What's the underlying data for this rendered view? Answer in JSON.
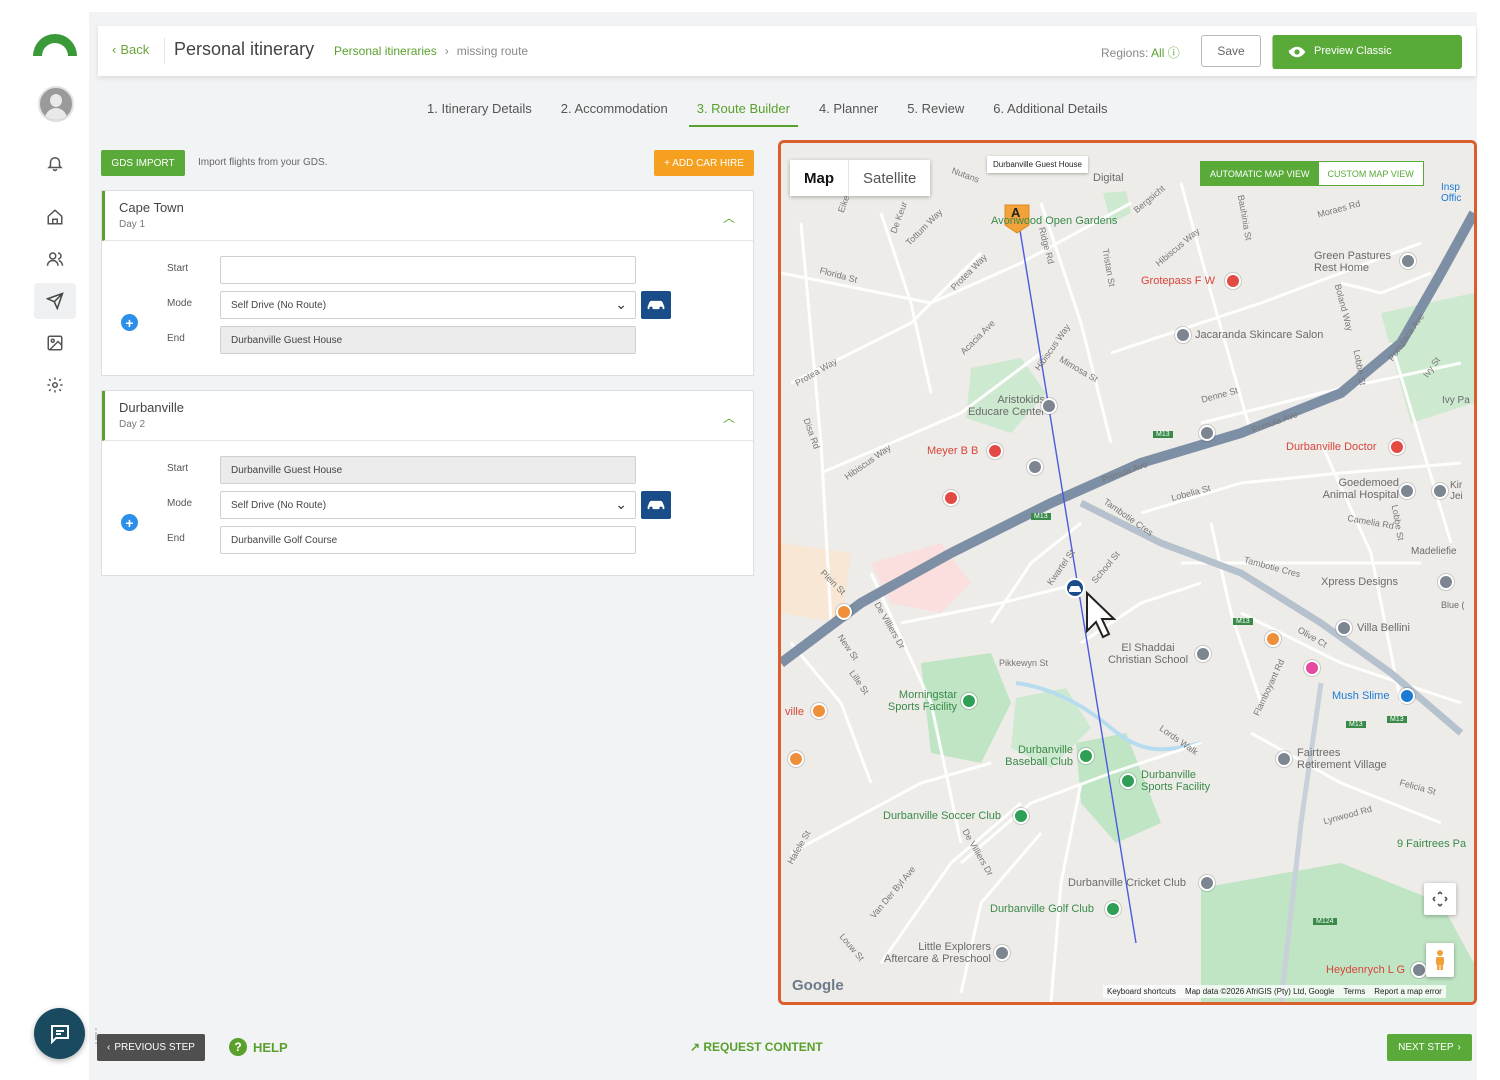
{
  "header": {
    "back_label": "Back",
    "title": "Personal itinerary",
    "breadcrumb_link": "Personal itineraries",
    "breadcrumb_sep": "›",
    "breadcrumb_current": "missing route",
    "regions_label": "Regions:",
    "regions_value": "All",
    "save_label": "Save",
    "preview_label": "Preview Classic"
  },
  "steps": [
    {
      "label": "1. Itinerary Details"
    },
    {
      "label": "2. Accommodation"
    },
    {
      "label": "3. Route Builder"
    },
    {
      "label": "4. Planner"
    },
    {
      "label": "5. Review"
    },
    {
      "label": "6. Additional Details"
    }
  ],
  "toolbar": {
    "gds_label": "GDS IMPORT",
    "gds_text": "Import flights from your GDS.",
    "car_hire_label": "+ ADD CAR HIRE"
  },
  "days": [
    {
      "title": "Cape Town",
      "day": "Day 1",
      "start_label": "Start",
      "start_value": "",
      "mode_label": "Mode",
      "mode_value": "Self Drive (No Route)",
      "end_label": "End",
      "end_value": "Durbanville Guest House"
    },
    {
      "title": "Durbanville",
      "day": "Day 2",
      "start_label": "Start",
      "start_value": "Durbanville Guest House",
      "mode_label": "Mode",
      "mode_value": "Self Drive (No Route)",
      "end_label": "End",
      "end_value": "Durbanville Golf Course"
    }
  ],
  "map": {
    "type_map": "Map",
    "type_satellite": "Satellite",
    "marker_tooltip": "Durbanville Guest House",
    "marker_letter": "A",
    "auto_view": "AUTOMATIC MAP VIEW",
    "custom_view": "CUSTOM MAP VIEW",
    "google": "Google",
    "footer": [
      "Keyboard shortcuts",
      "Map data ©2026 AfriGIS (Pty) Ltd, Google",
      "Terms",
      "Report a map error"
    ],
    "places": {
      "open_gardens": "Avonwood Open Gardens",
      "grotepass": "Grotepass F W",
      "jacaranda": "Jacaranda Skincare Salon",
      "green_pastures": "Green Pastures Rest Home",
      "aristokids": "Aristokids Educare Center",
      "meyer": "Meyer B B",
      "durbanville_doctor": "Durbanville Doctor",
      "goedemoed": "Goedemoed Animal Hospital",
      "xpress": "Xpress Designs",
      "villa_bellini": "Villa Bellini",
      "el_shaddai": "El Shaddai Christian School",
      "mush_slime": "Mush Slime",
      "morningstar": "Morningstar Sports Facility",
      "baseball": "Durbanville Baseball Club",
      "sports_facility": "Durbanville Sports Facility",
      "fairtrees": "Fairtrees Retirement Village",
      "soccer": "Durbanville Soccer Club",
      "nine_fairtrees": "9 Fairtrees Pa",
      "cricket": "Durbanville Cricket Club",
      "golf": "Durbanville Golf Club",
      "little_explorers": "Little Explorers Aftercare & Preschool",
      "heydenrych": "Heydenrych L G",
      "ville": "ville",
      "digital": "Digital",
      "insp": "Insp Offic",
      "madeliefie": "Madeliefie",
      "blue": "Blue (",
      "ivy": "Ivy Pa",
      "kir": "Kir Jei"
    },
    "streets": {
      "florida": "Florida St",
      "protea_way": "Protea Way",
      "protea_way2": "Protea Way",
      "disa": "Disa Rd",
      "hibiscus": "Hibiscus Way",
      "hibiscus2": "Hibiscus Way",
      "hibiscus3": "Hibiscus Way",
      "plein": "Plein St",
      "de_villiers": "De Villiers Dr",
      "de_villiers2": "De Villiers Dr",
      "new": "New St",
      "lille": "Lille St",
      "pikkewyn": "Pikkewyn St",
      "lords_walk": "Lords Walk",
      "hafele": "Hafele St",
      "van_der_byl": "Van Der Byl Ave",
      "louw": "Louw St",
      "primula": "Primula Ave",
      "primula2": "Primula Ave",
      "lobelia": "Lobelia St",
      "tambotie": "Tambotie Cres",
      "tambotie2": "Tambotie Cres",
      "camelia": "Camelia Rd",
      "lobbe": "Lobbe St",
      "lobbe2": "Lobbe St",
      "ridge": "Ridge Rd",
      "nutans": "Nutans",
      "acacia": "Acacia Ave",
      "school": "School St",
      "mimosa": "Mimosa St",
      "denne": "Denne St",
      "moraes": "Moraes Rd",
      "bolandweg": "Boland Way",
      "felicia": "Felicia St",
      "lynwood": "Lynwood Rd",
      "olive": "Olive Ct",
      "flamboyant": "Flamboyant Rd",
      "bergsicht": "Bergsicht",
      "tottum": "Tottum Way",
      "de_keur": "De Keur",
      "eike": "Eike Rd",
      "tiatian": "Tristan St",
      "bauhinia": "Bauhinia St",
      "portulaca": "Portulaca Ave",
      "ivy": "Ivy St",
      "kwartel": "Kwartel St"
    },
    "roads": {
      "m13a": "M13",
      "m13b": "M13",
      "m13c": "M13",
      "m13d": "M13",
      "m13e": "M13",
      "m124": "M124"
    }
  },
  "footer": {
    "prev_label": "PREVIOUS STEP",
    "help_label": "HELP",
    "request_label": "↗ REQUEST CONTENT",
    "next_label": "NEXT STEP"
  },
  "colors": {
    "brand_green": "#5aaa3a",
    "orange": "#f6a020",
    "navy": "#1a4c8a",
    "highlight": "#d9602c"
  }
}
